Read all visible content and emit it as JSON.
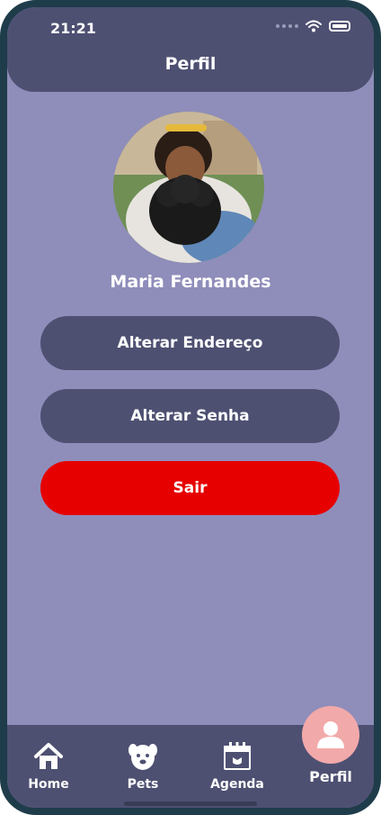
{
  "status_bar": {
    "time": "21:21"
  },
  "header": {
    "title": "Perfil"
  },
  "profile": {
    "name": "Maria Fernandes"
  },
  "actions": {
    "change_address": "Alterar Endereço",
    "change_password": "Alterar Senha",
    "logout": "Sair"
  },
  "tabs": [
    {
      "label": "Home",
      "icon": "home-icon"
    },
    {
      "label": "Pets",
      "icon": "dog-icon"
    },
    {
      "label": "Agenda",
      "icon": "calendar-icon"
    },
    {
      "label": "Perfil",
      "icon": "user-icon"
    }
  ],
  "colors": {
    "background": "#8f8dba",
    "primary_dark": "#4e5072",
    "danger": "#e60000",
    "active_tab": "#f2a9a9"
  }
}
